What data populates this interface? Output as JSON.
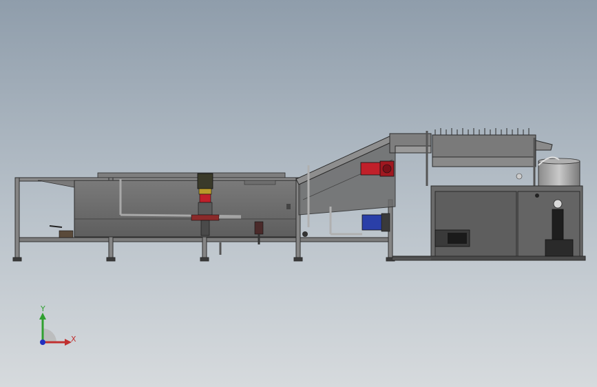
{
  "viewport": {
    "background_top": "#8f9dab",
    "background_bottom": "#d6dadd"
  },
  "model": {
    "steel_color": "#6b6b6b",
    "steel_dark": "#3f3f3f",
    "motor_red": "#c0202a",
    "motor_blue": "#2a3fa8",
    "pump_yellow": "#b89a2a",
    "tank_gray": "#8a8a8a"
  },
  "triad": {
    "x_label": "X",
    "y_label": "Y",
    "x_color": "#c03030",
    "y_color": "#30a030",
    "z_color": "#2030c0"
  }
}
